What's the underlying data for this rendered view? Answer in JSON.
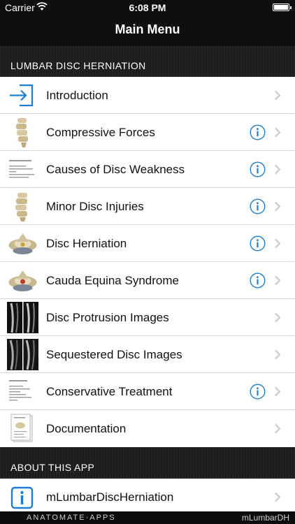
{
  "status_bar": {
    "carrier": "Carrier",
    "time": "6:08 PM"
  },
  "nav": {
    "title": "Main Menu"
  },
  "sections": [
    {
      "header": "LUMBAR DISC HERNIATION",
      "items": [
        {
          "label": "Introduction",
          "icon": "enter-icon",
          "info": false
        },
        {
          "label": "Compressive Forces",
          "icon": "spine-thumbnail",
          "info": true
        },
        {
          "label": "Causes of Disc Weakness",
          "icon": "document-thumbnail",
          "info": true
        },
        {
          "label": "Minor Disc Injuries",
          "icon": "spine-thumbnail",
          "info": true
        },
        {
          "label": "Disc Herniation",
          "icon": "vertebra-thumbnail",
          "info": true
        },
        {
          "label": "Cauda Equina Syndrome",
          "icon": "vertebra-thumbnail",
          "info": true
        },
        {
          "label": "Disc Protrusion Images",
          "icon": "mri-thumbnail",
          "info": false
        },
        {
          "label": "Sequestered Disc Images",
          "icon": "mri-thumbnail",
          "info": false
        },
        {
          "label": "Conservative Treatment",
          "icon": "document-thumbnail",
          "info": true
        },
        {
          "label": "Documentation",
          "icon": "documentation-thumbnail",
          "info": false
        }
      ]
    },
    {
      "header": "ABOUT THIS APP",
      "items": [
        {
          "label": "mLumbarDiscHerniation",
          "icon": "info-icon",
          "info": false
        }
      ]
    }
  ],
  "footer": {
    "brand": "ANATOMATE·APPS",
    "app_name": "mLumbarDH"
  },
  "colors": {
    "accent": "#1a7fd4",
    "chevron": "#c7c7cc",
    "bar": "#0f0f0f"
  }
}
